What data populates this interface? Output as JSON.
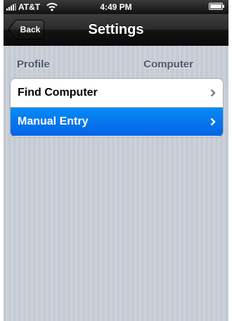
{
  "status_bar": {
    "carrier": "AT&T",
    "time": "4:49 PM",
    "signal_icon": "signal-bars-icon",
    "wifi_icon": "wifi-icon",
    "battery_icon": "battery-icon"
  },
  "nav_bar": {
    "back_label": "Back",
    "title": "Settings"
  },
  "section": {
    "left_header": "Profile",
    "right_header": "Computer"
  },
  "rows": [
    {
      "label": "Find Computer",
      "selected": false,
      "accessory": "chevron-right-icon"
    },
    {
      "label": "Manual Entry",
      "selected": true,
      "accessory": "chevron-right-icon"
    }
  ],
  "colors": {
    "selected_row": "#0570ea",
    "nav_bar": "#1a1a1a",
    "header_text": "#4c566c"
  }
}
